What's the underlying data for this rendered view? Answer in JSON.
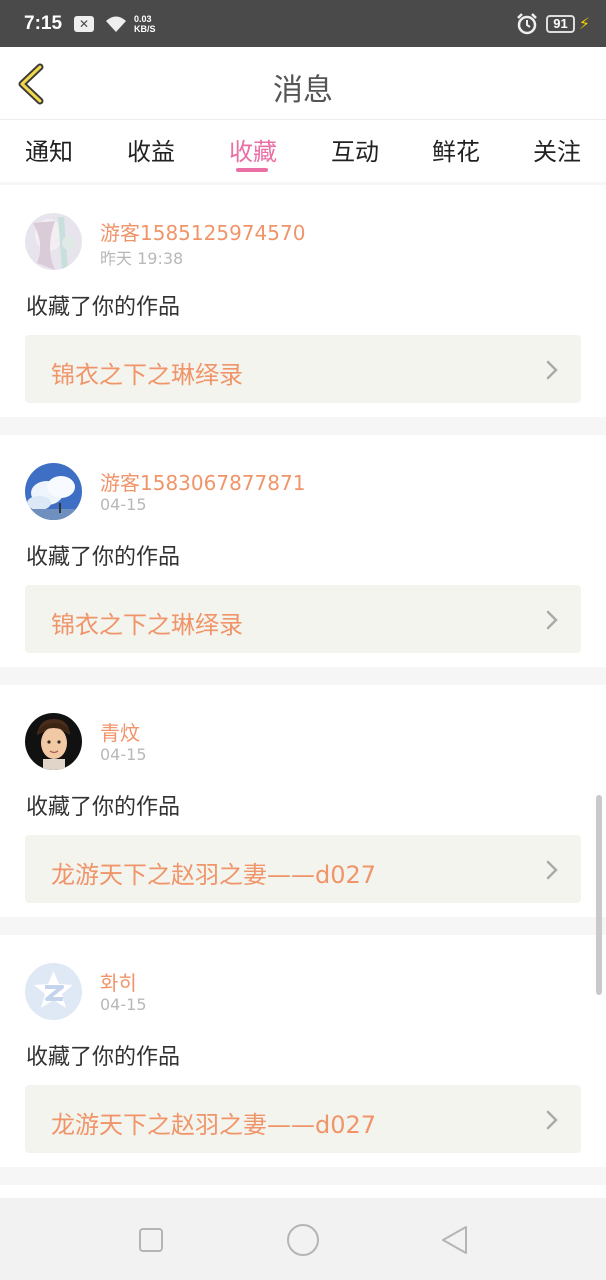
{
  "status_bar": {
    "time": "7:15",
    "speed_value": "0.03",
    "speed_unit": "KB/S",
    "battery": "91",
    "icons": [
      "notification-x-icon",
      "wifi-icon",
      "alarm-icon",
      "battery-icon",
      "charging-bolt-icon"
    ]
  },
  "header": {
    "title": "消息",
    "back_icon": "chevron-left-icon"
  },
  "tabs": [
    {
      "label": "通知"
    },
    {
      "label": "收益"
    },
    {
      "label": "收藏",
      "active": true
    },
    {
      "label": "互动"
    },
    {
      "label": "鲜花"
    },
    {
      "label": "关注"
    }
  ],
  "messages": [
    {
      "user": "游客1585125974570",
      "time": "昨天 19:38",
      "action": "收藏了你的作品",
      "work": "锦衣之下之琳绎录",
      "avatar": "anime-girl-avatar"
    },
    {
      "user": "游客1583067877871",
      "time": "04-15",
      "action": "收藏了你的作品",
      "work": "锦衣之下之琳绎录",
      "avatar": "sky-clouds-avatar"
    },
    {
      "user": "青炆",
      "time": "04-15",
      "action": "收藏了你的作品",
      "work": "龙游天下之赵羽之妻——d027",
      "avatar": "cartoon-boy-avatar"
    },
    {
      "user": "화히",
      "time": "04-15",
      "action": "收藏了你的作品",
      "work": "龙游天下之赵羽之妻——d027",
      "avatar": "qzone-default-avatar"
    }
  ],
  "colors": {
    "accent": "#e96fa5",
    "username": "#f0956a",
    "status_bar": "#4a4a4a",
    "work_bg": "#f4f4ee"
  },
  "navbar": {
    "icons": [
      "recent-apps-square-icon",
      "home-circle-icon",
      "back-triangle-icon"
    ]
  }
}
